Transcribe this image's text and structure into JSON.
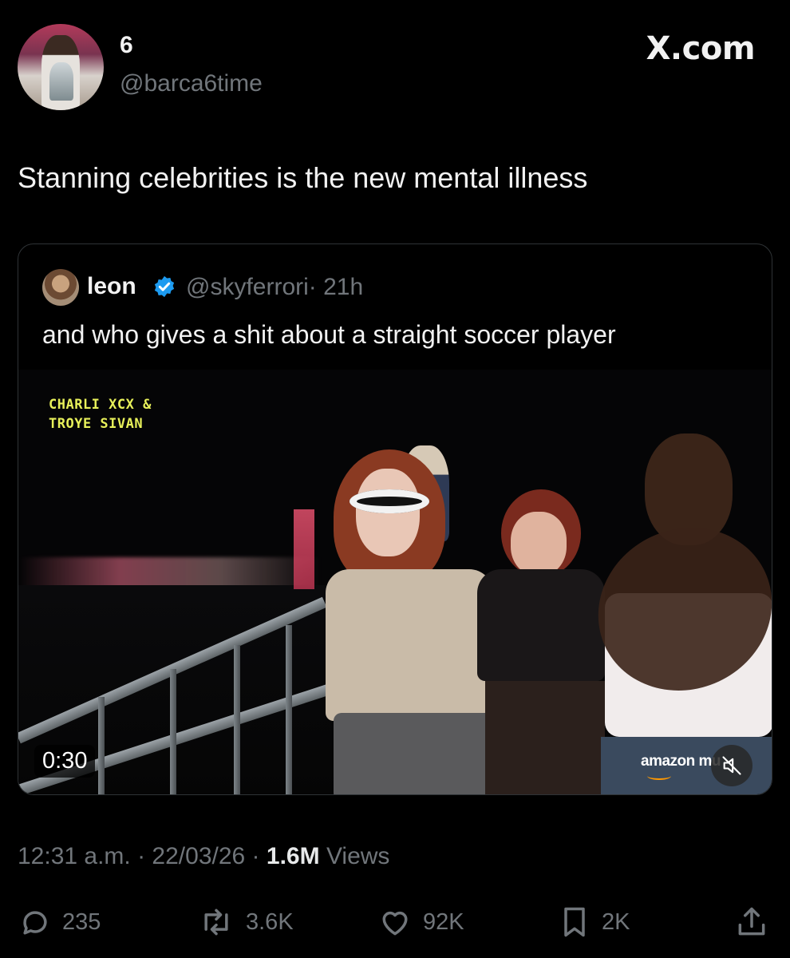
{
  "author": {
    "display_name": "6",
    "handle": "@barca6time"
  },
  "brand": {
    "label": "X.com"
  },
  "tweet": {
    "text": "Stanning celebrities is the new mental illness"
  },
  "quote": {
    "author_name": "leon",
    "author_handle": "@skyferrori",
    "time_ago": "· 21h",
    "text": "and who gives a shit about a straight soccer player",
    "media": {
      "overlay_title": "CHARLI XCX &\nTROYE SIVAN",
      "duration": "0:30",
      "watermark": "amazon mu"
    }
  },
  "meta": {
    "time": "12:31 a.m.",
    "date": "· 22/03/26 ·",
    "views_count": "1.6M",
    "views_label": "Views"
  },
  "actions": {
    "replies": "235",
    "reposts": "3.6K",
    "likes": "92K",
    "bookmarks": "2K"
  },
  "colors": {
    "background": "#000000",
    "text_primary": "#e7e9ea",
    "text_secondary": "#71767b",
    "verified": "#1d9bf0",
    "border": "#2f3336",
    "overlay_title": "#e7f05a"
  }
}
